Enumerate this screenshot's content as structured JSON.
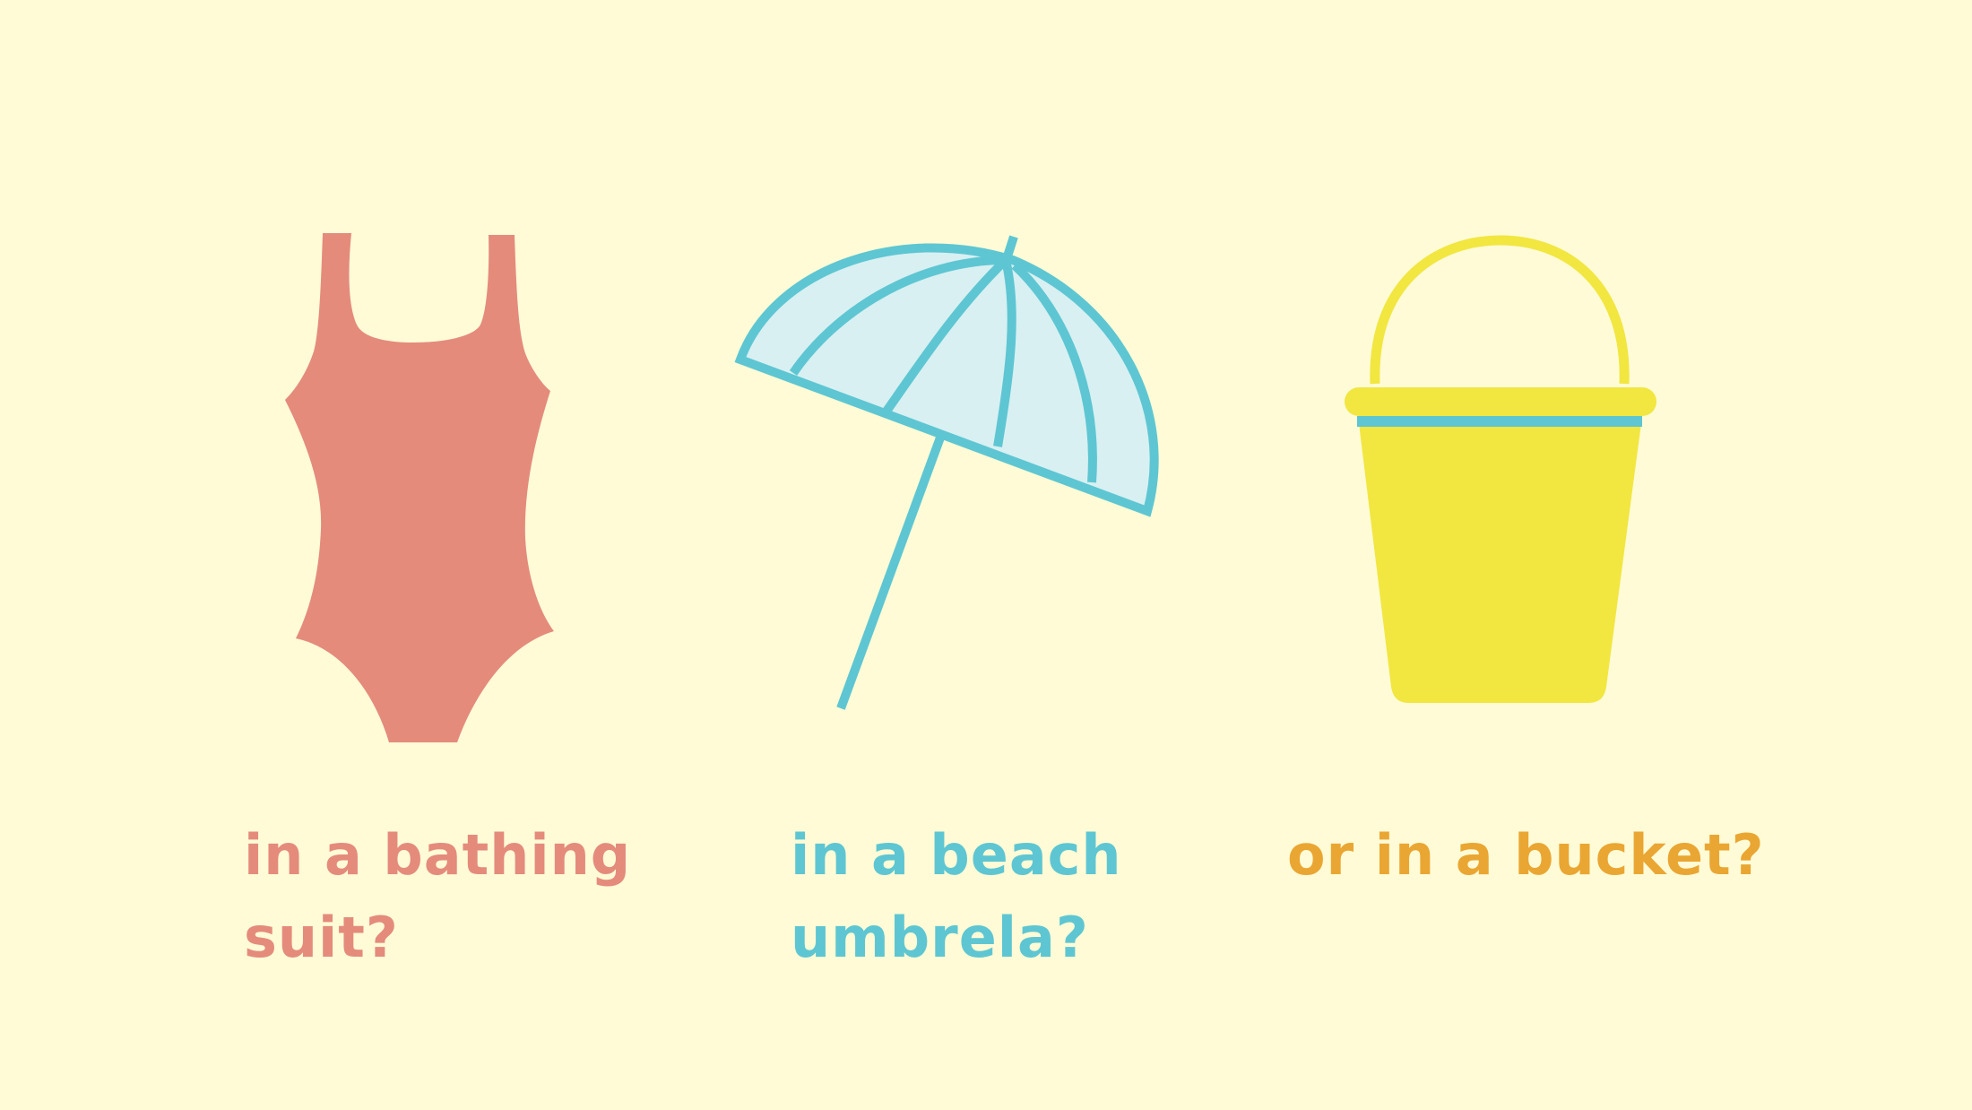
{
  "slide": {
    "background": "#fefbd6",
    "items": [
      {
        "icon": "swimsuit-icon",
        "color": "#e48b7c",
        "caption_lines": [
          "in a bathing",
          "suit?"
        ]
      },
      {
        "icon": "beach-umbrella-icon",
        "color": "#5ec6d2",
        "canopy_fill": "#d8f0f2",
        "caption_lines": [
          "in a beach",
          "umbrela?"
        ]
      },
      {
        "icon": "bucket-icon",
        "color": "#f2e640",
        "band_color": "#5ec6d2",
        "text_color": "#eaa632",
        "caption_lines": [
          "or in a bucket?"
        ]
      }
    ]
  }
}
